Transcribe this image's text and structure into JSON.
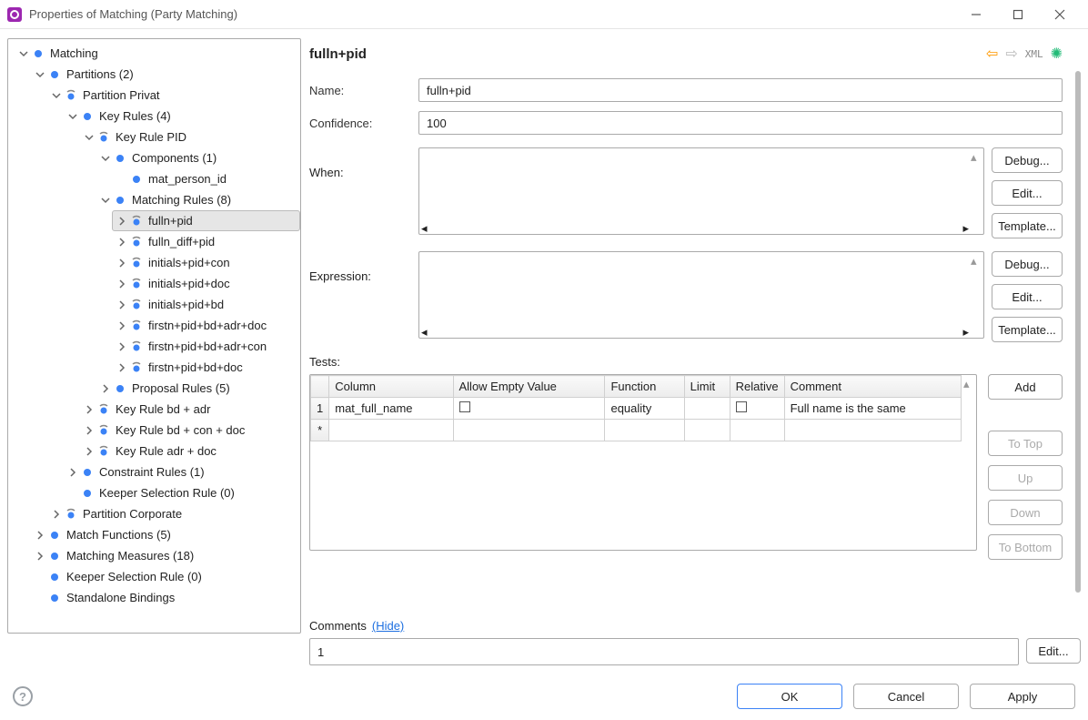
{
  "window": {
    "title": "Properties of Matching (Party Matching)"
  },
  "tree": {
    "root": "Matching",
    "partitions": "Partitions (2)",
    "partition_privat": "Partition Privat",
    "key_rules": "Key Rules (4)",
    "key_rule_pid": "Key Rule PID",
    "components": "Components (1)",
    "mat_person_id": "mat_person_id",
    "matching_rules": "Matching Rules (8)",
    "mr": [
      "fulln+pid",
      "fulln_diff+pid",
      "initials+pid+con",
      "initials+pid+doc",
      "initials+pid+bd",
      "firstn+pid+bd+adr+doc",
      "firstn+pid+bd+adr+con",
      "firstn+pid+bd+doc"
    ],
    "proposal_rules": "Proposal Rules (5)",
    "kr_bd_adr": "Key Rule bd + adr",
    "kr_bd_con_doc": "Key Rule bd + con + doc",
    "kr_adr_doc": "Key Rule adr + doc",
    "constraint_rules": "Constraint Rules (1)",
    "keeper_sel": "Keeper Selection Rule (0)",
    "partition_corp": "Partition Corporate",
    "match_fns": "Match Functions (5)",
    "matching_measures": "Matching Measures (18)",
    "keeper_sel2": "Keeper Selection Rule (0)",
    "standalone": "Standalone Bindings"
  },
  "form": {
    "heading": "fulln+pid",
    "name_label": "Name:",
    "name_value": "fulln+pid",
    "confidence_label": "Confidence:",
    "confidence_value": "100",
    "when_label": "When:",
    "expression_label": "Expression:",
    "debug": "Debug...",
    "edit": "Edit...",
    "template": "Template..."
  },
  "tests": {
    "label": "Tests:",
    "headers": {
      "column": "Column",
      "allow_empty": "Allow Empty Value",
      "function": "Function",
      "limit": "Limit",
      "relative": "Relative",
      "comment": "Comment"
    },
    "rows": [
      {
        "num": "1",
        "column": "mat_full_name",
        "allow_empty": false,
        "function": "equality",
        "limit": "",
        "relative": false,
        "comment": "Full name is the same"
      }
    ],
    "new_marker": "*",
    "buttons": {
      "add": "Add",
      "to_top": "To Top",
      "up": "Up",
      "down": "Down",
      "to_bottom": "To Bottom"
    }
  },
  "comments": {
    "label": "Comments",
    "hide": "(Hide)",
    "value": "1",
    "edit": "Edit..."
  },
  "footer": {
    "ok": "OK",
    "cancel": "Cancel",
    "apply": "Apply"
  },
  "toolbar_icons": {
    "xml": "XML"
  }
}
